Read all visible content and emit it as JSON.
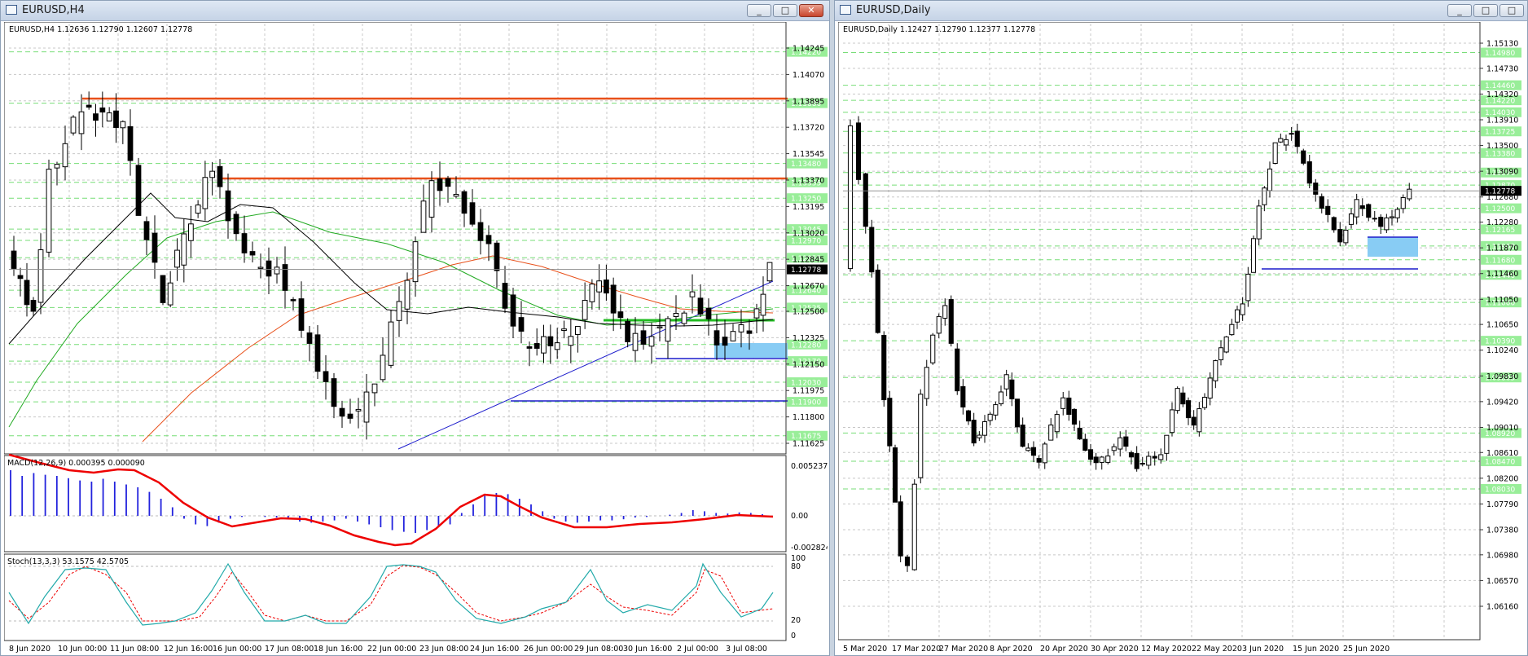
{
  "colors": {
    "level_bg": "#99ee99",
    "hline": "#e8501a",
    "trend": "#1c1ccc",
    "zone": "#88ccf4",
    "ma_red": "#e8501a",
    "ma_green": "#22aa22",
    "ma_black": "#000000",
    "macd": "#2222dd",
    "signal": "#ee0000",
    "stoch_main": "#22aaaa",
    "stoch_sig": "#ee0000",
    "green_line": "#22bb22"
  },
  "left": {
    "title": "EURUSD,H4",
    "header": "EURUSD,H4  1.12636 1.12790 1.12607 1.12778",
    "ticks": [
      "1.14245",
      "1.14070",
      "1.13895",
      "1.13720",
      "1.13545",
      "1.13370",
      "1.13195",
      "1.13020",
      "1.12845",
      "1.12670",
      "1.12500",
      "1.12325",
      "1.12150",
      "1.11975",
      "1.11800",
      "1.11625"
    ],
    "levels": [
      "1.14220",
      "1.13880",
      "1.13480",
      "1.13355",
      "1.13250",
      "1.13045",
      "1.12970",
      "1.12855",
      "1.12640",
      "1.12525",
      "1.12280",
      "1.12170",
      "1.12030",
      "1.11900",
      "1.11675"
    ],
    "current_price": "1.12778",
    "macd_header": "MACD(12,26,9) 0.000395 0.000090",
    "macd_ticks": [
      "0.005237",
      "0.00",
      "-0.002824"
    ],
    "stoch_header": "Stoch(13,3,3) 53.1575 42.5705",
    "stoch_ticks": [
      "100",
      "80",
      "20",
      "0"
    ],
    "xticks": [
      "8 Jun 2020",
      "10 Jun 00:00",
      "11 Jun 08:00",
      "12 Jun 16:00",
      "16 Jun 00:00",
      "17 Jun 08:00",
      "18 Jun 16:00",
      "22 Jun 00:00",
      "23 Jun 08:00",
      "24 Jun 16:00",
      "26 Jun 00:00",
      "29 Jun 08:00",
      "30 Jun 16:00",
      "2 Jul 00:00",
      "3 Jul 08:00"
    ]
  },
  "right": {
    "title": "EURUSD,Daily",
    "header": "EURUSD,Daily  1.12427 1.12790 1.12377 1.12778",
    "ticks": [
      "1.15130",
      "1.14730",
      "1.14320",
      "1.13910",
      "1.13500",
      "1.13090",
      "1.12680",
      "1.12280",
      "1.11870",
      "1.11460",
      "1.11050",
      "1.10650",
      "1.10240",
      "1.09830",
      "1.09420",
      "1.09010",
      "1.08610",
      "1.08200",
      "1.07790",
      "1.07380",
      "1.06980",
      "1.06570",
      "1.06160"
    ],
    "levels": [
      "1.14980",
      "1.14460",
      "1.14220",
      "1.14030",
      "1.13725",
      "1.13380",
      "1.13070",
      "1.12870",
      "1.12500",
      "1.12165",
      "1.11900",
      "1.11680",
      "1.11440",
      "1.11000",
      "1.10390",
      "1.09805",
      "1.08920",
      "1.08470",
      "1.08030"
    ],
    "current_price": "1.12778",
    "xticks": [
      "5 Mar 2020",
      "17 Mar 2020",
      "27 Mar 2020",
      "8 Apr 2020",
      "20 Apr 2020",
      "30 Apr 2020",
      "12 May 2020",
      "22 May 2020",
      "3 Jun 2020",
      "15 Jun 2020",
      "25 Jun 2020"
    ]
  },
  "buttons": {
    "minimize": "_",
    "maximize": "□",
    "close": "✕"
  }
}
